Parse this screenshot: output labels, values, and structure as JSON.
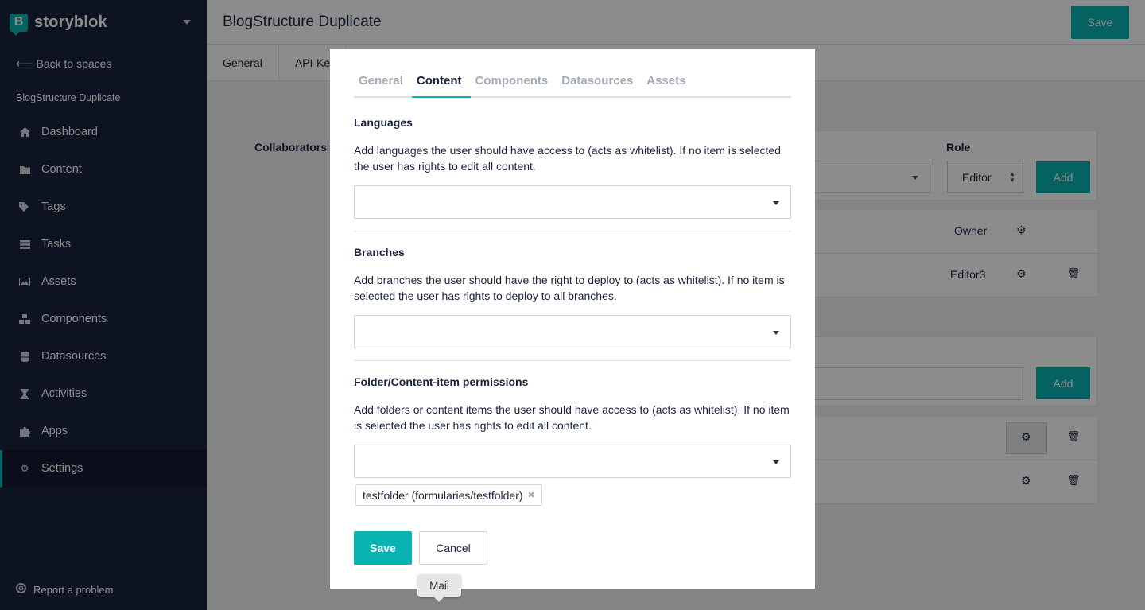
{
  "brand": {
    "logo_letter": "B",
    "name": "storyblok"
  },
  "sidebar": {
    "back_label": "Back to spaces",
    "space_name": "BlogStructure Duplicate",
    "items": [
      {
        "label": "Dashboard",
        "icon": "home-icon"
      },
      {
        "label": "Content",
        "icon": "folder-icon"
      },
      {
        "label": "Tags",
        "icon": "tags-icon"
      },
      {
        "label": "Tasks",
        "icon": "tasks-icon"
      },
      {
        "label": "Assets",
        "icon": "image-icon"
      },
      {
        "label": "Components",
        "icon": "cubes-icon"
      },
      {
        "label": "Datasources",
        "icon": "database-icon"
      },
      {
        "label": "Activities",
        "icon": "hourglass-icon"
      },
      {
        "label": "Apps",
        "icon": "puzzle-icon"
      },
      {
        "label": "Settings",
        "icon": "gear-icon"
      }
    ],
    "report_label": "Report a problem"
  },
  "header": {
    "title": "BlogStructure Duplicate",
    "save_label": "Save"
  },
  "subtabs": [
    "General",
    "API-Ke"
  ],
  "background": {
    "collaborators_label": "Collaborators",
    "role_header": "Role",
    "role_value": "Editor",
    "add_label": "Add",
    "rows": [
      {
        "role": "Owner"
      },
      {
        "role": "Editor3"
      }
    ]
  },
  "modal": {
    "tabs": [
      "General",
      "Content",
      "Components",
      "Datasources",
      "Assets"
    ],
    "active_tab": "Content",
    "languages": {
      "title": "Languages",
      "desc": "Add languages the user should have access to (acts as whitelist). If no item is selected the user has rights to edit all content."
    },
    "branches": {
      "title": "Branches",
      "desc": "Add branches the user should have the right to deploy to (acts as whitelist). If no item is selected the user has rights to deploy to all branches."
    },
    "folders": {
      "title": "Folder/Content-item permissions",
      "desc": "Add folders or content items the user should have access to (acts as whitelist). If no item is selected the user has rights to edit all content.",
      "chip": "testfolder (formularies/testfolder)"
    },
    "save_label": "Save",
    "cancel_label": "Cancel"
  },
  "tooltip": "Mail",
  "colors": {
    "accent": "#09b3af",
    "sidebar": "#1b243f"
  }
}
